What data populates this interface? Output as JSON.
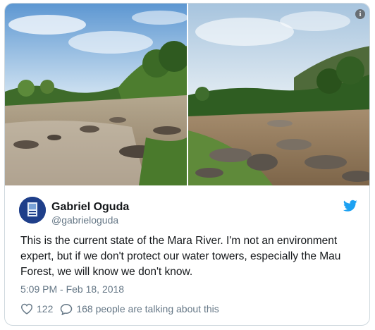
{
  "tweet": {
    "author_name": "Gabriel Oguda",
    "author_handle": "@gabrieloguda",
    "text": "This is the current state of the Mara River. I'm not an environment expert, but if we don't protect our water towers, especially the Mau Forest, we will know we don't know.",
    "timestamp": "5:09 PM - Feb 18, 2018",
    "likes": "122",
    "replies_label": "168 people are talking about this"
  },
  "icons": {
    "info": "info-icon",
    "bird": "twitter-bird-icon",
    "heart": "heart-icon",
    "reply": "reply-bubble-icon"
  },
  "colors": {
    "twitter_blue": "#1da1f2",
    "text": "#14171a",
    "muted": "#657786",
    "border": "#cfd9de"
  }
}
